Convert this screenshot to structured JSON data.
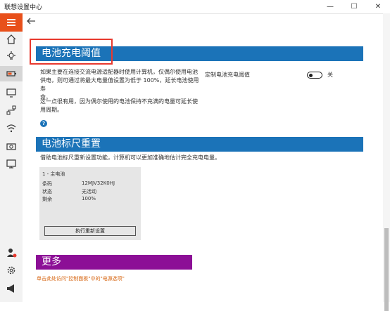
{
  "window": {
    "title": "联想设置中心",
    "minimize": "—",
    "maximize": "☐",
    "close": "✕"
  },
  "sidebar": {
    "items": [
      "menu-icon",
      "home-icon",
      "lightbulb-icon",
      "battery-icon",
      "display-icon",
      "network-icon",
      "wifi-icon",
      "camera-icon",
      "monitor-icon",
      "user-icon",
      "gear-icon",
      "megaphone-icon"
    ],
    "accent": "#e8501b"
  },
  "threshold": {
    "header": "电池充电阈值",
    "desc_line1": "如果主要在连接交流电源适配器时使用计算机，仅偶尔使用电池",
    "desc_line2": "供电，则可通过将最大电量值设置为低于 100%，延长电池使用寿",
    "desc_line3": "命。",
    "note_line1": "这一点很有用，因为偶尔使用的电池保持不充满的电量可延长使",
    "note_line2": "用周期。",
    "toggle_label": "定制电池充电阈值",
    "toggle_state": "关",
    "toggle_on": false,
    "help": "?"
  },
  "gauge": {
    "header": "电池标尺重置",
    "desc": "借助电池标尺重新设置功能，计算机可以更加准确地估计完全充电电量。",
    "card": {
      "title": "1 - 主电池",
      "rows": [
        {
          "label": "条码",
          "value": "12MJV32K0HJ"
        },
        {
          "label": "状态",
          "value": "无活动"
        },
        {
          "label": "剩余",
          "value": "100%"
        }
      ],
      "button": "执行重新设置"
    }
  },
  "more": {
    "header": "更多",
    "link": "单击此处访问\"控制面板\"中的\"电源选项\""
  },
  "colors": {
    "section_blue": "#1b73b8",
    "section_purple": "#8c0f96",
    "highlight_red": "#e8392e",
    "link_orange": "#d6620c"
  }
}
